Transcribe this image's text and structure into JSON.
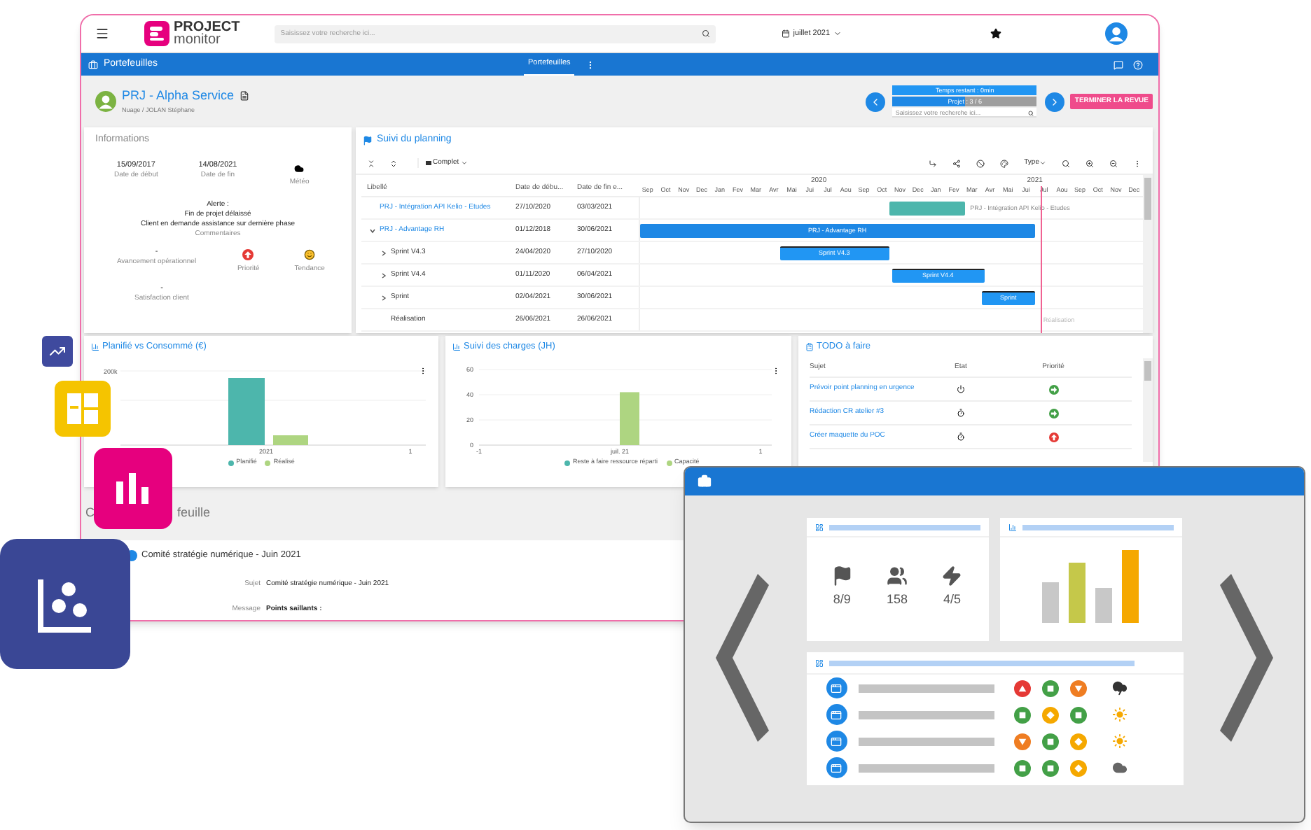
{
  "header": {
    "logo_top": "PROJECT",
    "logo_bottom": "monitor",
    "search": {
      "placeholder": "Saisissez votre recherche ici..."
    },
    "period": "juillet 2021"
  },
  "navbar": {
    "title": "Portefeuilles",
    "tabs": [
      {
        "label": "Portefeuilles",
        "selected": true
      }
    ]
  },
  "project": {
    "name": "PRJ - Alpha Service",
    "path": "Nuage / JOLAN Stéphane",
    "time_left": "Temps restant : 0min",
    "progress": {
      "label": "Projet : 3 / 6",
      "level": 0.5
    },
    "search": {
      "placeholder": "Saisissez votre recherche ici..."
    },
    "finish_button": "TERMINER LA REVUE"
  },
  "informations": {
    "title": "Informations",
    "start": {
      "value": "15/09/2017",
      "label": "Date de début"
    },
    "end": {
      "value": "14/08/2021",
      "label": "Date de fin"
    },
    "weather": {
      "label": "Météo"
    },
    "alert": [
      "Alerte :",
      "Fin de projet délaissé",
      "Client en demande assistance sur dernière phase"
    ],
    "comment_label": "Commentaires",
    "progress": {
      "value": "-",
      "label": "Avancement opérationnel"
    },
    "priority": {
      "label": "Priorité"
    },
    "trend": {
      "label": "Tendance"
    },
    "satisfaction": {
      "value": "-",
      "label": "Satisfaction client"
    }
  },
  "planning": {
    "title": "Suivi du planning",
    "view": "Complet",
    "type_menu": "Type",
    "columns": [
      "Libellé",
      "Date de débu...",
      "Date de fin e..."
    ],
    "years": [
      "2020",
      "2021"
    ],
    "months": [
      "Sep",
      "Oct",
      "Nov",
      "Dec",
      "Jan",
      "Fev",
      "Mar",
      "Avr",
      "Mai",
      "Jui",
      "Jul",
      "Aou",
      "Sep",
      "Oct",
      "Nov",
      "Dec",
      "Jan",
      "Fev",
      "Mar",
      "Avr",
      "Mai",
      "Jui",
      "Jul",
      "Aou",
      "Sep",
      "Oct",
      "Nov",
      "Dec"
    ],
    "rows": [
      {
        "kind": "project",
        "label": "PRJ - Intégration API Kelio - Etudes",
        "start": "27/10/2020",
        "end": "03/03/2021",
        "color": "#4db6ac",
        "bar_label": "PRJ - Intégration API Kelio - Etudes",
        "label_inside": false
      },
      {
        "kind": "project",
        "label": "PRJ - Advantage RH",
        "start": "01/12/2018",
        "end": "30/06/2021",
        "color": "#1e88e5",
        "bar_label": "PRJ - Advantage RH",
        "label_inside": true,
        "expanded": true,
        "children": [
          {
            "kind": "sprint",
            "label": "Sprint V4.3",
            "start": "24/04/2020",
            "end": "27/10/2020",
            "color": "#2196f3",
            "bar_label": "Sprint V4.3",
            "label_inside": true,
            "expanded": false
          },
          {
            "kind": "sprint",
            "label": "Sprint V4.4",
            "start": "01/11/2020",
            "end": "06/04/2021",
            "color": "#2196f3",
            "bar_label": "Sprint V4.4",
            "label_inside": true,
            "expanded": false
          },
          {
            "kind": "sprint",
            "label": "Sprint",
            "start": "02/04/2021",
            "end": "30/06/2021",
            "color": "#2196f3",
            "bar_label": "Sprint",
            "label_inside": true,
            "expanded": false
          },
          {
            "kind": "milestone",
            "label": "Réalisation",
            "start": "26/06/2021",
            "end": "26/06/2021",
            "bar_label": "Réalisation",
            "label_inside": false
          }
        ]
      }
    ]
  },
  "planned_chart": {
    "title": "Planifié vs Consommé (€)",
    "ytick": "200k",
    "xlabels": [
      "2021",
      "1"
    ],
    "legend": [
      {
        "label": "Planifié",
        "color": "#4db6ac"
      },
      {
        "label": "Réalisé",
        "color": "#aed581"
      }
    ]
  },
  "load_chart": {
    "title": "Suivi des charges (JH)",
    "x_edge_labels": [
      "-1",
      "1"
    ],
    "chart_data": {
      "type": "bar",
      "categories": [
        "juil. 21"
      ],
      "series": [
        {
          "name": "Reste à faire ressource réparti",
          "color": "#4db6ac",
          "values": [
            null
          ]
        },
        {
          "name": "Capacité",
          "color": "#aed581",
          "values": [
            42
          ]
        }
      ],
      "ylim": [
        0,
        60
      ],
      "yticks": [
        0,
        20,
        40,
        60
      ]
    }
  },
  "todo": {
    "title": "TODO à faire",
    "columns": [
      "Sujet",
      "Etat",
      "Priorité"
    ],
    "rows": [
      {
        "subject": "Prévoir point planning en urgence",
        "started": true,
        "urgent": false
      },
      {
        "subject": "Rédaction CR atelier #3",
        "started": false,
        "urgent": false
      },
      {
        "subject": "Créer maquette du POC",
        "started": false,
        "urgent": true
      }
    ]
  },
  "section": {
    "heading_start": "C",
    "heading_end": "feuille"
  },
  "meeting": {
    "title": "Comité stratégie numérique - Juin 2021",
    "fields": [
      {
        "label": "Sujet",
        "value": "Comité stratégie numérique - Juin 2021",
        "bold": false
      },
      {
        "label": "Message",
        "value": "Points saillants :",
        "bold": true
      }
    ]
  },
  "preview": {
    "kpis": [
      {
        "kind": "flag",
        "value": "8/9"
      },
      {
        "kind": "people",
        "value": "158"
      },
      {
        "kind": "bolt",
        "value": "4/5"
      }
    ],
    "rows": [
      {
        "dots": [
          {
            "kind": "up",
            "color": "#e53935"
          },
          {
            "kind": "square",
            "color": "#43a047"
          },
          {
            "kind": "down",
            "color": "#ef7d22"
          }
        ],
        "weather": {
          "kind": "storm"
        }
      },
      {
        "dots": [
          {
            "kind": "square",
            "color": "#43a047"
          },
          {
            "kind": "diamond",
            "color": "#f5a800"
          },
          {
            "kind": "square",
            "color": "#43a047"
          }
        ],
        "weather": {
          "kind": "sun"
        }
      },
      {
        "dots": [
          {
            "kind": "down",
            "color": "#ef7d22"
          },
          {
            "kind": "square",
            "color": "#43a047"
          },
          {
            "kind": "diamond",
            "color": "#f5a800"
          }
        ],
        "weather": {
          "kind": "sun"
        }
      },
      {
        "dots": [
          {
            "kind": "square",
            "color": "#43a047"
          },
          {
            "kind": "square",
            "color": "#43a047"
          },
          {
            "kind": "diamond",
            "color": "#f5a800"
          }
        ],
        "weather": {
          "kind": "cloud"
        }
      }
    ]
  }
}
